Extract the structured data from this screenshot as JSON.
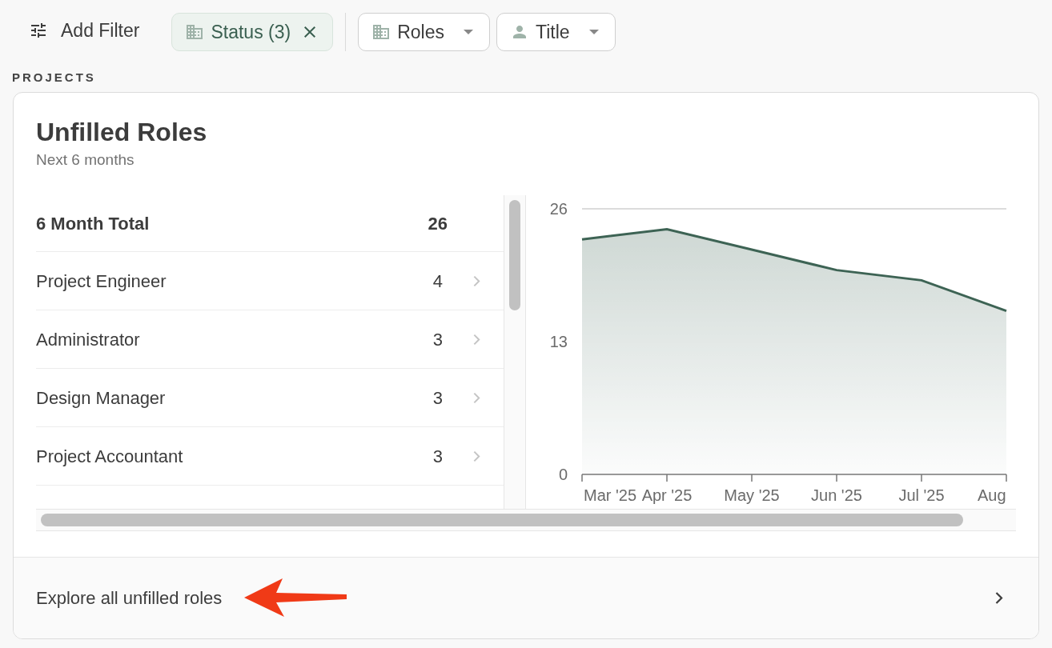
{
  "filter_bar": {
    "add_filter": "Add Filter",
    "chips": [
      {
        "kind": "active",
        "label": "Status (3)"
      },
      {
        "kind": "dropdown",
        "label": "Roles"
      },
      {
        "kind": "dropdown",
        "label": "Title"
      }
    ]
  },
  "section_label": "PROJECTS",
  "card": {
    "title": "Unfilled Roles",
    "subtitle": "Next 6 months",
    "total": {
      "label": "6 Month Total",
      "count": "26"
    },
    "roles": [
      {
        "name": "Project Engineer",
        "count": "4"
      },
      {
        "name": "Administrator",
        "count": "3"
      },
      {
        "name": "Design Manager",
        "count": "3"
      },
      {
        "name": "Project Accountant",
        "count": "3"
      }
    ],
    "chart_data": {
      "type": "area",
      "categories": [
        "Mar '25",
        "Apr '25",
        "May '25",
        "Jun '25",
        "Jul '25",
        "Aug"
      ],
      "series": [
        {
          "color": "#3d6354",
          "values": [
            23,
            24,
            22,
            20,
            19,
            16
          ]
        }
      ],
      "ylim": [
        0,
        26
      ],
      "yticks": [
        0,
        13,
        26
      ]
    },
    "footer_link": "Explore all unfilled roles"
  }
}
